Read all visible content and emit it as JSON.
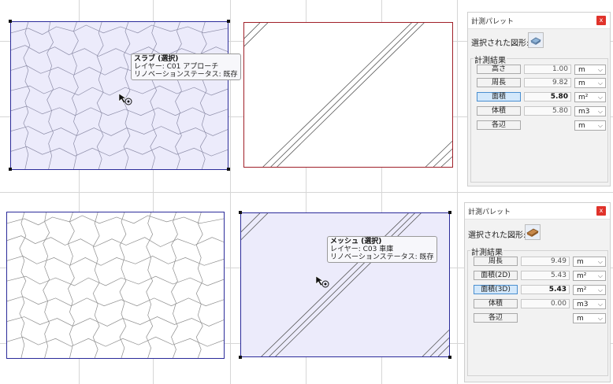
{
  "top": {
    "tooltip": {
      "title": "スラブ (選択)",
      "layer": "レイヤー: C01 アプローチ",
      "status": "リノベーションステータス: 既存"
    },
    "panel": {
      "title": "計測パレット",
      "close": "x",
      "selected_label": "選択された図形:",
      "selected_icon": "slab-icon",
      "group_title": "計測結果",
      "rows": [
        {
          "label": "高さ",
          "value": "1.00",
          "unit": "m"
        },
        {
          "label": "周長",
          "value": "9.82",
          "unit": "m"
        },
        {
          "label": "面積",
          "value": "5.80",
          "unit": "m²"
        },
        {
          "label": "体積",
          "value": "5.80",
          "unit": "m3"
        },
        {
          "label": "各辺",
          "value": "",
          "unit": "m"
        }
      ]
    }
  },
  "bottom": {
    "tooltip": {
      "title": "メッシュ (選択)",
      "layer": "レイヤー: C03 車庫",
      "status": "リノベーションステータス: 既存"
    },
    "panel": {
      "title": "計測パレット",
      "close": "x",
      "selected_label": "選択された図形:",
      "selected_icon": "mesh-icon",
      "group_title": "計測結果",
      "rows": [
        {
          "label": "周長",
          "value": "9.49",
          "unit": "m"
        },
        {
          "label": "面積(2D)",
          "value": "5.43",
          "unit": "m²"
        },
        {
          "label": "面積(3D)",
          "value": "5.43",
          "unit": "m²"
        },
        {
          "label": "体積",
          "value": "0.00",
          "unit": "m3"
        },
        {
          "label": "各辺",
          "value": "",
          "unit": "m"
        }
      ]
    }
  },
  "colors": {
    "selection_fill": "#ecebfb",
    "selection_stroke": "#2b2b9a",
    "hatch_stroke_red": "#a01f28",
    "active_field": "#d3e8fb",
    "close_button": "#e0332b"
  }
}
